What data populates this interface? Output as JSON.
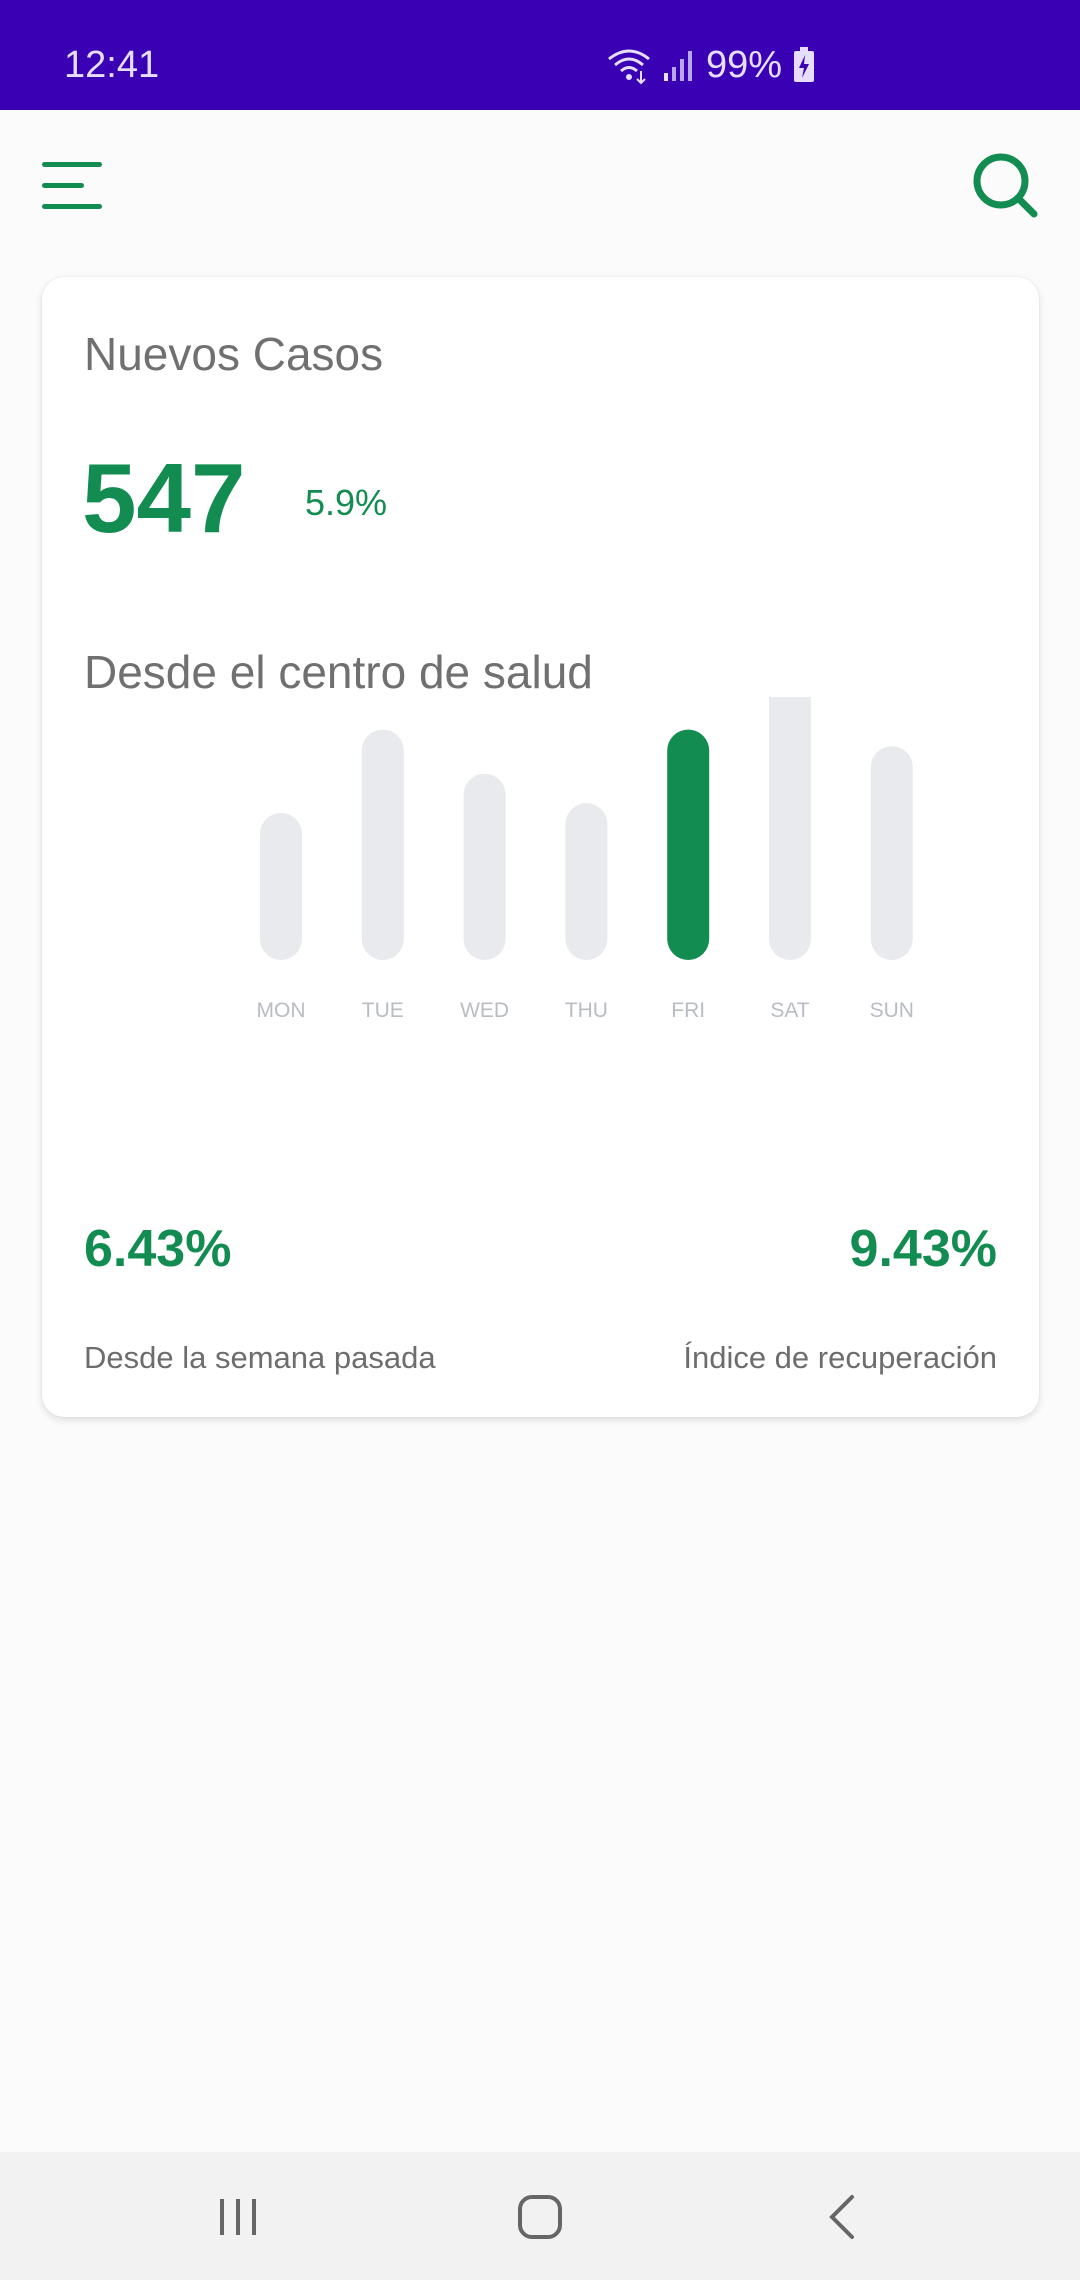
{
  "status_bar": {
    "time": "12:41",
    "battery": "99%",
    "icons": [
      "wifi-icon",
      "signal-icon",
      "battery-charging-icon"
    ]
  },
  "app_bar": {
    "icons": [
      "menu-icon",
      "search-icon"
    ]
  },
  "card": {
    "title": "Nuevos Casos",
    "big_number": "547",
    "big_percent": "5.9%",
    "subtitle": "Desde el centro de salud",
    "stat_left": {
      "value": "6.43%",
      "label": "Desde la semana pasada"
    },
    "stat_right": {
      "value": "9.43%",
      "label": "Índice de recuperación"
    }
  },
  "chart_data": {
    "type": "bar",
    "categories": [
      "MON",
      "TUE",
      "WED",
      "THU",
      "FRI",
      "SAT",
      "SUN"
    ],
    "values": [
      150,
      235,
      190,
      160,
      235,
      360,
      218
    ],
    "highlight_index": 4,
    "ylim": [
      0,
      360
    ],
    "grid": false,
    "axis_visible": false
  },
  "colors": {
    "status_bar": "#3a00b4",
    "accent": "#128c50",
    "bar_inactive": "#e9eaed",
    "bar_active": "#128c50",
    "tick_label": "#b9bcc2"
  },
  "nav_bar": {
    "icons": [
      "recent-apps-icon",
      "home-icon",
      "back-icon"
    ]
  }
}
